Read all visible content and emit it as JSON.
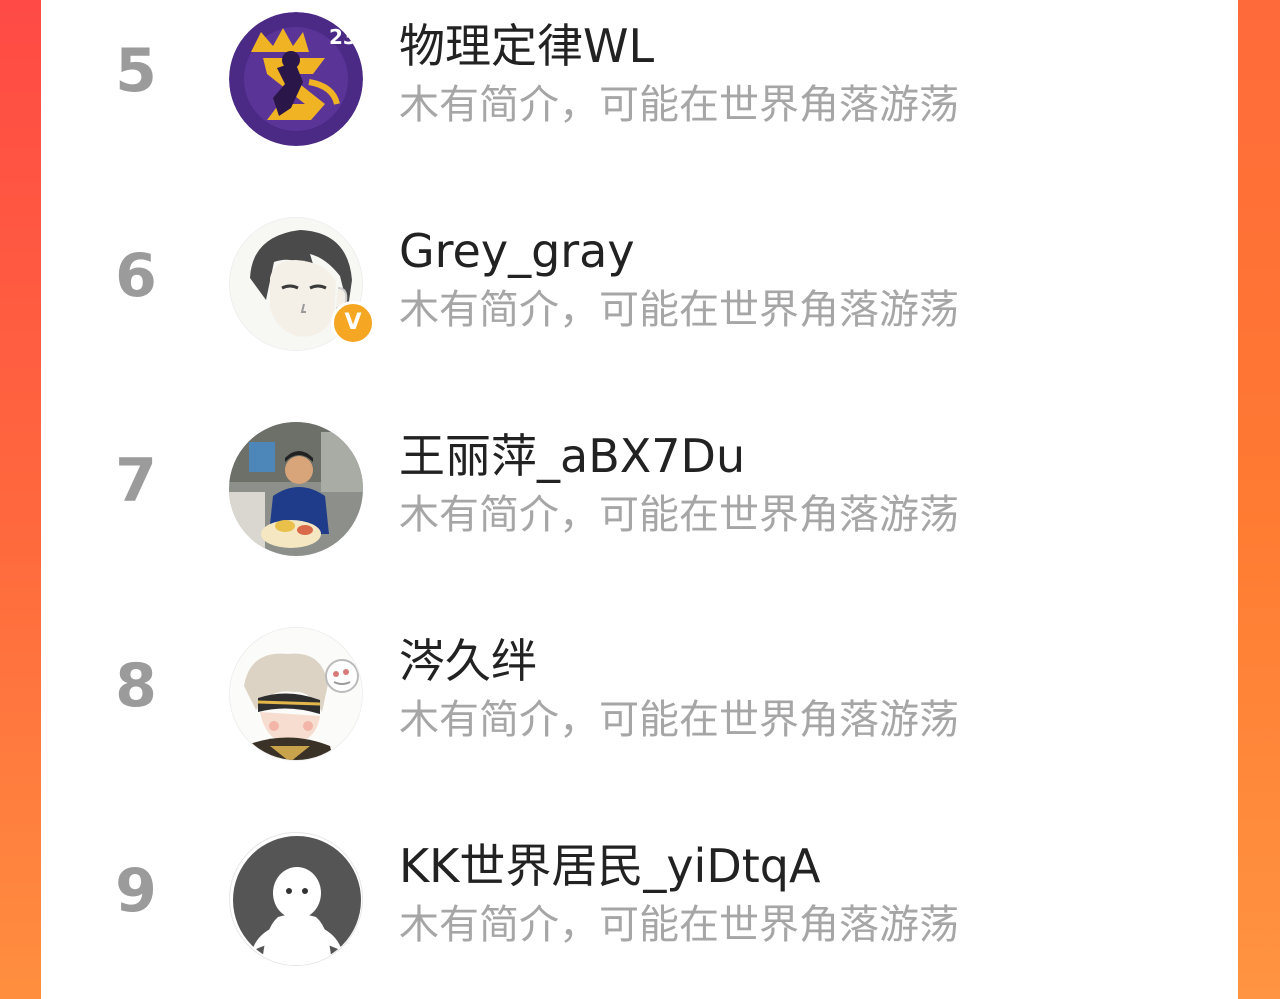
{
  "colors": {
    "background_left": "#ff4a45",
    "background_right": "#ff8a3c",
    "panel": "#ffffff",
    "rank": "#9b9b9b",
    "name": "#222222",
    "bio": "#a6a6a6",
    "verified_badge": "#f5a623"
  },
  "users": [
    {
      "rank": "5",
      "name": "物理定律WL",
      "bio": "木有简介，可能在世界角落游荡",
      "avatar": "basketball-player-avatar-icon",
      "avatar_text": "23"
    },
    {
      "rank": "6",
      "name": "Grey_gray",
      "bio": "木有简介，可能在世界角落游荡",
      "avatar": "anime-boy-avatar-icon",
      "badge": "V"
    },
    {
      "rank": "7",
      "name": "王丽萍_aBX7Du",
      "bio": "木有简介，可能在世界角落游荡",
      "avatar": "child-photo-avatar-icon"
    },
    {
      "rank": "8",
      "name": "涔久绊",
      "bio": "木有简介，可能在世界角落游荡",
      "avatar": "chibi-character-avatar-icon"
    },
    {
      "rank": "9",
      "name": "KK世界居民_yiDtqA",
      "bio": "木有简介，可能在世界角落游荡",
      "avatar": "default-user-avatar-icon"
    }
  ]
}
